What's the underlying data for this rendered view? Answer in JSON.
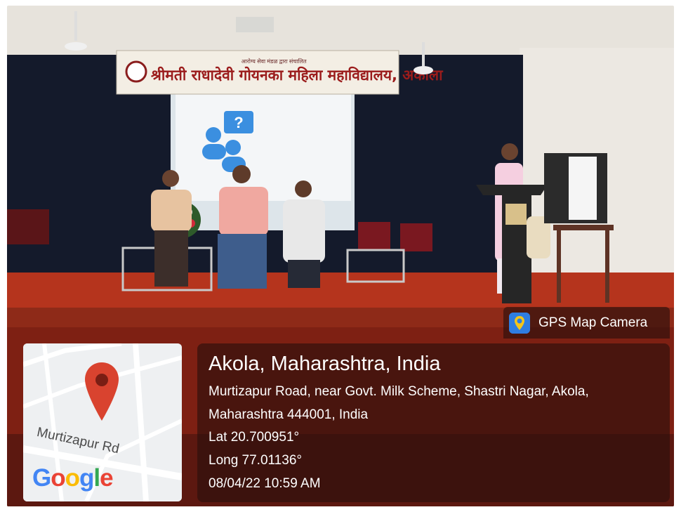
{
  "banner": {
    "small_text": "आरोग्य सेवा मंडळ द्वारा संचालित",
    "title": "श्रीमती राधादेवी गोयनका महिला महाविद्यालय, अकोला"
  },
  "badge": {
    "icon": "map-pin-camera-icon",
    "label": "GPS Map Camera"
  },
  "map": {
    "road_label": "Murtizapur Rd",
    "logo_letters": [
      "G",
      "o",
      "o",
      "g",
      "l",
      "e"
    ],
    "logo_colors": [
      "#4285F4",
      "#EA4335",
      "#FBBC05",
      "#4285F4",
      "#34A853",
      "#EA4335"
    ],
    "pin_color": "#d9432f"
  },
  "location": {
    "title": "Akola, Maharashtra, India",
    "address_line1": "Murtizapur Road, near Govt. Milk Scheme, Shastri Nagar, Akola,",
    "address_line2": "Maharashtra 444001, India",
    "lat": "Lat 20.700951°",
    "long": "Long 77.01136°",
    "datetime": "08/04/22 10:59 AM"
  }
}
